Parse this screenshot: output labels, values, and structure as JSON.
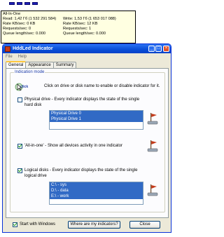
{
  "tooltip": {
    "title": "All-In-One",
    "read": "Read: 1,42 Гб (1 532 291 584)",
    "write": "Write: 1,53 Гб (1 653 017 088)",
    "rate_read": "Rate KB/sec: 0 KB",
    "rate_write": "Rate KB/sec: 12 KB",
    "requests_read": "Requests/sec: 0",
    "requests_write": "Requests/sec: 1",
    "queue_read": "Queue length/sec: 0.000",
    "queue_write": "Queue length/sec: 0.000"
  },
  "window": {
    "title": "HddLed Indicator",
    "menu": [
      "File",
      "Help"
    ],
    "tabs": [
      "General",
      "Appearance",
      "Summary"
    ],
    "active_tab": "General",
    "group_title": "Indication mode",
    "click_label": "click",
    "hint": "Click on drive or disk name to enable or disable indicator for it.",
    "physical_label_1": "Physical drive - Every indicator displays the state of the single",
    "physical_label_2": "hard disk",
    "physical_checked": false,
    "physical_drives": [
      "Physical Drive 0",
      "Physical Drive 1"
    ],
    "allinone_label": "'All-in-one' - Show all devices activity in one indicator",
    "allinone_checked": true,
    "logical_label_1": "Logical disks - Every indicator displays the state of the single",
    "logical_label_2": "logical drive",
    "logical_checked": true,
    "logical_disks": [
      "C:\\ - sys",
      "D:\\ - data",
      "E:\\ - work"
    ],
    "start_label": "Start with Windows",
    "start_checked": true,
    "where_button": "Where are my indicators?",
    "close_button": "Close"
  }
}
